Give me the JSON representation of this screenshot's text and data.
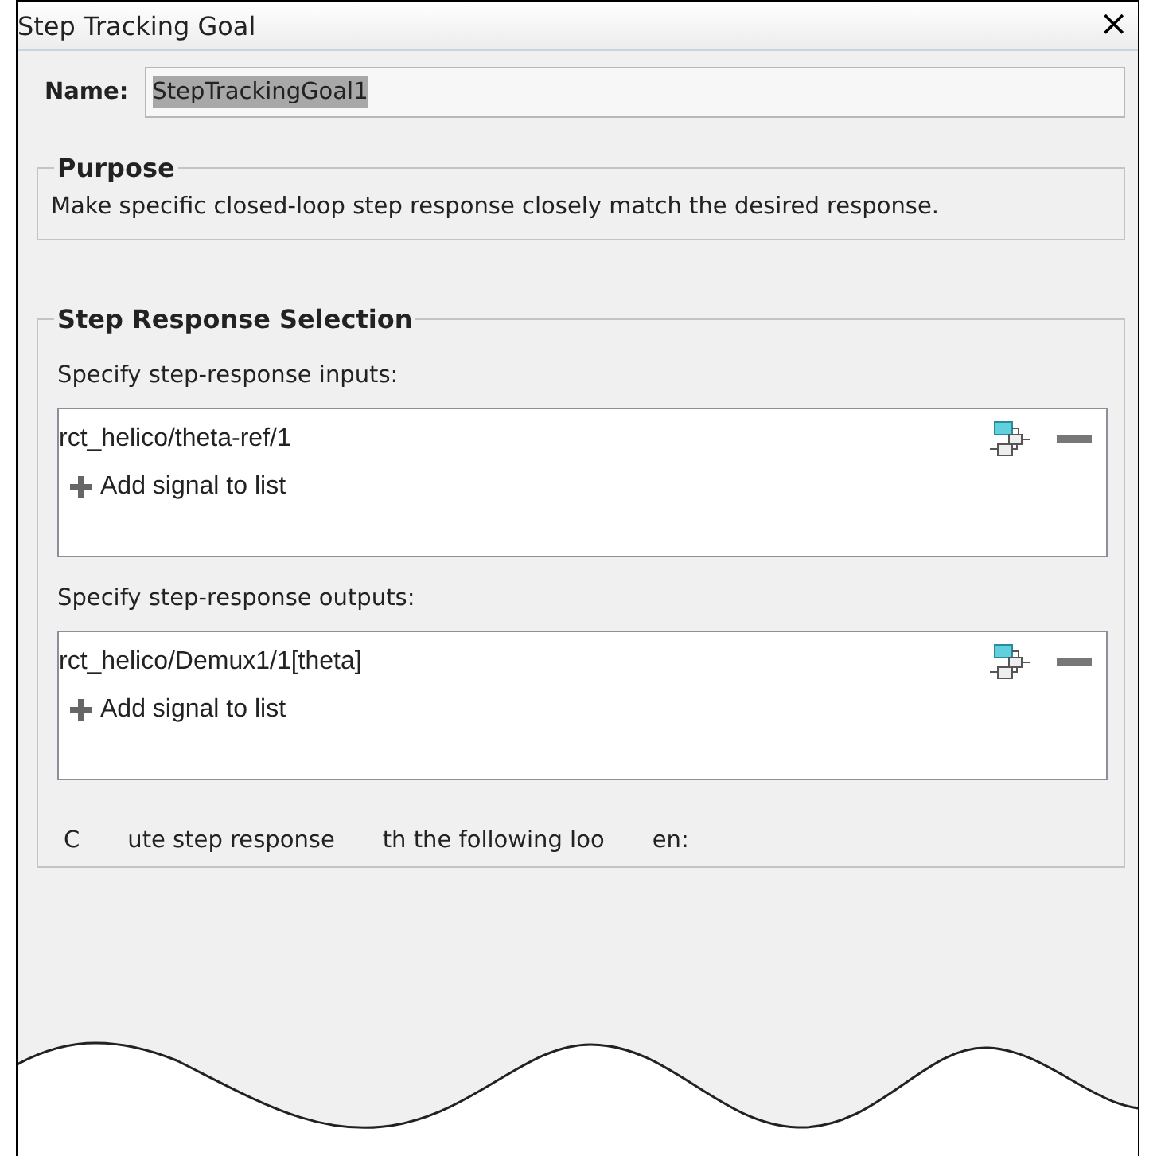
{
  "window": {
    "title": "Step Tracking Goal",
    "close": "×"
  },
  "name_field": {
    "label": "Name:",
    "value": "StepTrackingGoal1",
    "selected": true
  },
  "purpose": {
    "title": "Purpose",
    "text": "Make specific closed-loop step response closely match the desired response."
  },
  "step_response_selection": {
    "title": "Step Response Selection",
    "lists": [
      {
        "label": "Specify step-response inputs:",
        "signals": [
          "rct_helico/theta-ref/1"
        ],
        "add": "Add signal to list"
      },
      {
        "label": "Specify step-response outputs:",
        "signals": [
          "rct_helico/Demux1/1[theta]"
        ],
        "add": "Add signal to list"
      }
    ],
    "loops_label_fragments": [
      "C",
      "ute step response",
      "th the following loo",
      "en:"
    ]
  }
}
